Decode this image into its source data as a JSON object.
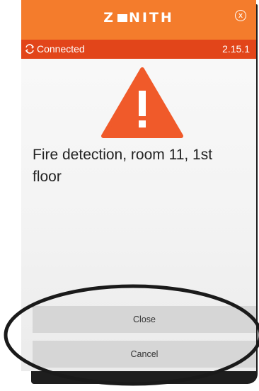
{
  "app": {
    "logo_text": "Z□NITH",
    "logo_left": "Z",
    "logo_right": "NITH"
  },
  "titlebar": {
    "close_glyph": "x",
    "color": "#f47c2c"
  },
  "status": {
    "connection_label": "Connected",
    "connection_icon": "sync-icon",
    "version": "2.15.1",
    "color": "#e2451a"
  },
  "alert": {
    "icon": "warning-icon",
    "icon_color": "#f05a2a",
    "message": "Fire detection, room 11, 1st floor"
  },
  "actions": {
    "close_label": "Close",
    "cancel_label": "Cancel"
  }
}
